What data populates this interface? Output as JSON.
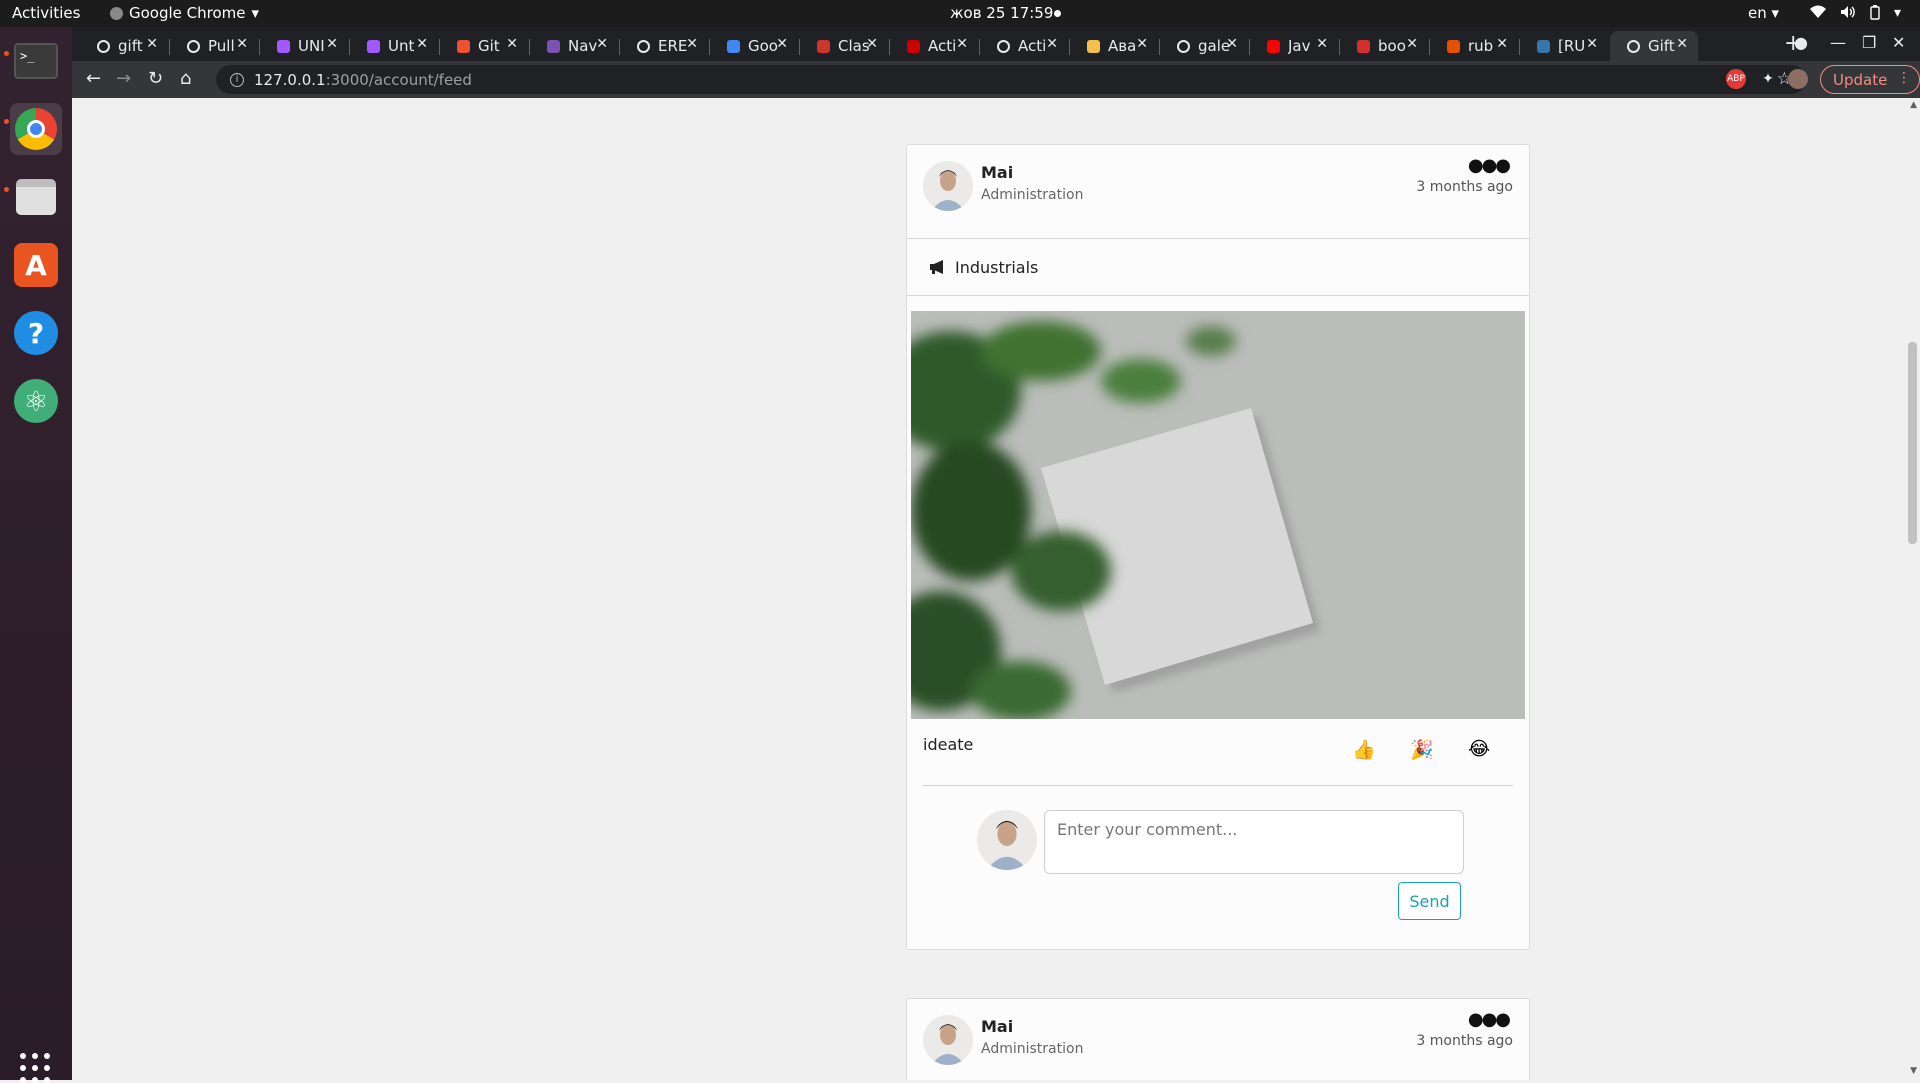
{
  "os": {
    "activities": "Activities",
    "app_name": "Google Chrome",
    "clock": "жов 25  17:59",
    "lang": "en"
  },
  "browser": {
    "tabs": [
      {
        "label": "gift",
        "favicon": "github-icon",
        "color": "#202124"
      },
      {
        "label": "Pull",
        "favicon": "github-icon",
        "color": "#202124"
      },
      {
        "label": "UNI",
        "favicon": "figma-icon",
        "color": "#a259ff"
      },
      {
        "label": "Unt",
        "favicon": "figma-icon",
        "color": "#a259ff"
      },
      {
        "label": "Git",
        "favicon": "git-icon",
        "color": "#f05032"
      },
      {
        "label": "Nav",
        "favicon": "bootstrap-icon",
        "color": "#7952b3"
      },
      {
        "label": "ERE",
        "favicon": "globe-icon",
        "color": "#5f6368"
      },
      {
        "label": "Goo",
        "favicon": "translate-icon",
        "color": "#4285f4"
      },
      {
        "label": "Clas",
        "favicon": "ruby-icon",
        "color": "#cc342d"
      },
      {
        "label": "Acti",
        "favicon": "rails-icon",
        "color": "#cc0000"
      },
      {
        "label": "Acti",
        "favicon": "globe-icon",
        "color": "#5f6368"
      },
      {
        "label": "Ава",
        "favicon": "yellow-icon",
        "color": "#f3c04c"
      },
      {
        "label": "gale",
        "favicon": "github-icon",
        "color": "#202124"
      },
      {
        "label": "Jav",
        "favicon": "youtube-icon",
        "color": "#ff0000"
      },
      {
        "label": "boo",
        "favicon": "book-icon",
        "color": "#d32f2f"
      },
      {
        "label": "rub",
        "favicon": "fire-icon",
        "color": "#e65100"
      },
      {
        "label": "[RU",
        "favicon": "python-icon",
        "color": "#3776ab"
      },
      {
        "label": "Gift",
        "favicon": "globe-icon",
        "color": "#5f6368",
        "active": true
      }
    ],
    "url_host": "127.0.0.1",
    "url_path": ":3000/account/feed",
    "update_label": "Update"
  },
  "feed": {
    "post1": {
      "author": "Mai",
      "role": "Administration",
      "time": "3 months ago",
      "topic": "Industrials",
      "text": "ideate",
      "reactions": [
        "👍",
        "🎉",
        "😂"
      ],
      "comment_placeholder": "Enter your comment...",
      "send_label": "Send"
    },
    "post2": {
      "author": "Mai",
      "role": "Administration",
      "time": "3 months ago"
    }
  },
  "colors": {
    "accent": "#17a2b8",
    "update": "#f28b82"
  }
}
